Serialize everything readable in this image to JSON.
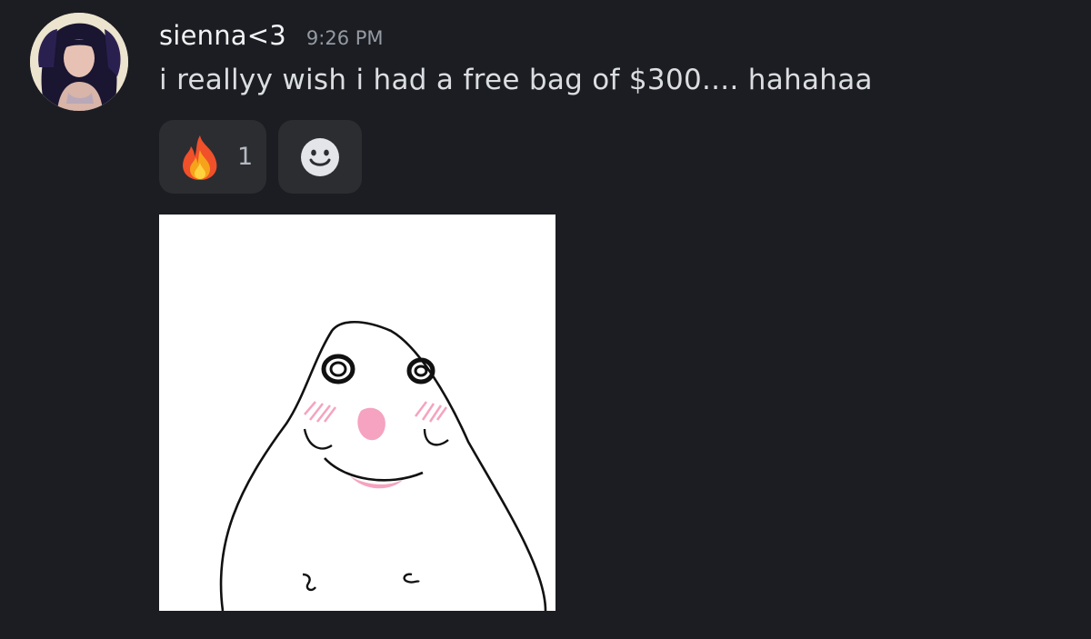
{
  "message": {
    "username": "sienna<3",
    "timestamp": "9:26 PM",
    "content": "i reallyy wish i had a free bag of $300.... hahahaa",
    "avatar_icon": "user-avatar-photo"
  },
  "reactions": [
    {
      "emoji": "fire-emoji",
      "count": "1"
    }
  ],
  "add_reaction": {
    "icon": "smiley-face-icon"
  },
  "attachment": {
    "icon": "blob-creature-meme-image"
  },
  "colors": {
    "background": "#1c1d22",
    "reaction_bg": "#2b2d31",
    "username": "#f2f3f5",
    "timestamp": "#949ba4",
    "text": "#dbdee1"
  }
}
